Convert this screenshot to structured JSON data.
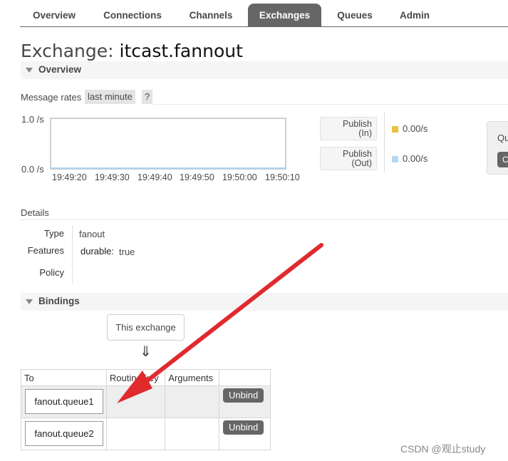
{
  "nav": {
    "tabs": [
      {
        "label": "Overview",
        "active": false
      },
      {
        "label": "Connections",
        "active": false
      },
      {
        "label": "Channels",
        "active": false
      },
      {
        "label": "Exchanges",
        "active": true
      },
      {
        "label": "Queues",
        "active": false
      },
      {
        "label": "Admin",
        "active": false
      }
    ]
  },
  "page": {
    "title_prefix": "Exchange:",
    "title_name": "itcast.fannout"
  },
  "overview": {
    "section_label": "Overview",
    "message_rates_label": "Message rates",
    "range_label": "last minute",
    "help_label": "?",
    "chart": {
      "y_max_label": "1.0 /s",
      "y_min_label": "0.0 /s",
      "x_ticks": [
        "19:49:20",
        "19:49:30",
        "19:49:40",
        "19:49:50",
        "19:50:00",
        "19:50:10"
      ]
    },
    "legend": [
      {
        "line1": "Publish",
        "line2": "(In)",
        "value": "0.00/s",
        "color": "#e8c13c"
      },
      {
        "line1": "Publish",
        "line2": "(Out)",
        "value": "0.00/s",
        "color": "#b2d8f5"
      }
    ],
    "side_panel": {
      "label": "Qu",
      "button_label": "C"
    }
  },
  "details": {
    "section_label": "Details",
    "type_key": "Type",
    "type_value": "fanout",
    "features_key": "Features",
    "features_name": "durable:",
    "features_value": "true",
    "policy_key": "Policy"
  },
  "bindings": {
    "section_label": "Bindings",
    "source_label": "This exchange",
    "arrow_glyph": "⇓",
    "columns": [
      "To",
      "Routing key",
      "Arguments",
      ""
    ],
    "rows": [
      {
        "queue": "fanout.queue1",
        "routing_key": "",
        "arguments": "",
        "action": "Unbind"
      },
      {
        "queue": "fanout.queue2",
        "routing_key": "",
        "arguments": "",
        "action": "Unbind"
      }
    ]
  },
  "watermark": "CSDN @观止study",
  "colors": {
    "accent": "#666666",
    "annotation_arrow": "#e02a2e"
  }
}
